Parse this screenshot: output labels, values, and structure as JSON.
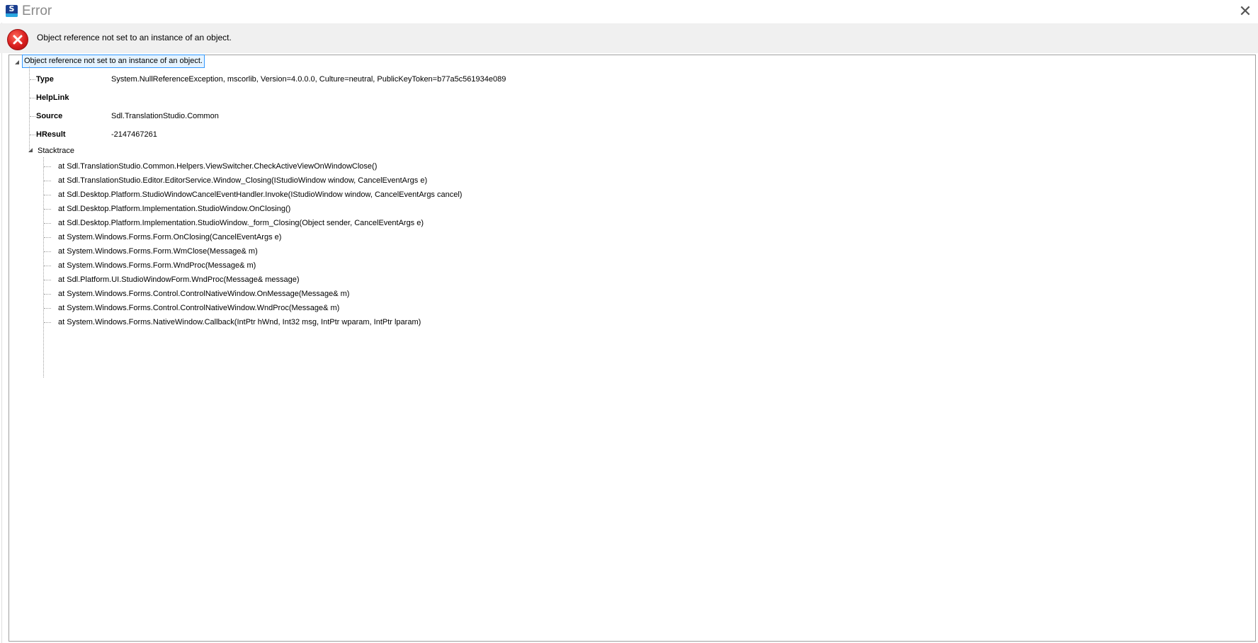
{
  "window": {
    "title": "Error",
    "close_glyph": "✕"
  },
  "header": {
    "message": "Object reference not set to an instance of an object."
  },
  "tree": {
    "root_label": "Object reference not set to an instance of an object.",
    "properties": [
      {
        "name": "Type",
        "value": "System.NullReferenceException, mscorlib, Version=4.0.0.0, Culture=neutral, PublicKeyToken=b77a5c561934e089"
      },
      {
        "name": "HelpLink",
        "value": ""
      },
      {
        "name": "Source",
        "value": "Sdl.TranslationStudio.Common"
      },
      {
        "name": "HResult",
        "value": "-2147467261"
      }
    ],
    "stacktrace_label": "Stacktrace",
    "stacktrace": [
      "at Sdl.TranslationStudio.Common.Helpers.ViewSwitcher.CheckActiveViewOnWindowClose()",
      "at Sdl.TranslationStudio.Editor.EditorService.Window_Closing(IStudioWindow window, CancelEventArgs e)",
      "at Sdl.Desktop.Platform.StudioWindowCancelEventHandler.Invoke(IStudioWindow window, CancelEventArgs cancel)",
      "at Sdl.Desktop.Platform.Implementation.StudioWindow.OnClosing()",
      "at Sdl.Desktop.Platform.Implementation.StudioWindow._form_Closing(Object sender, CancelEventArgs e)",
      "at System.Windows.Forms.Form.OnClosing(CancelEventArgs e)",
      "at System.Windows.Forms.Form.WmClose(Message& m)",
      "at System.Windows.Forms.Form.WndProc(Message& m)",
      "at Sdl.Platform.UI.StudioWindowForm.WndProc(Message& message)",
      "at System.Windows.Forms.Control.ControlNativeWindow.OnMessage(Message& m)",
      "at System.Windows.Forms.Control.ControlNativeWindow.WndProc(Message& m)",
      "at System.Windows.Forms.NativeWindow.Callback(IntPtr hWnd, Int32 msg, IntPtr wparam, IntPtr lparam)"
    ]
  },
  "colors": {
    "header_bg": "#f0f0f0",
    "selection_border": "#3399ff",
    "selection_bg": "#e5f3ff",
    "error_red": "#d81e1e"
  },
  "icons": {
    "app": "sdl-studio-icon",
    "error": "error-x-icon",
    "close": "close-icon"
  }
}
